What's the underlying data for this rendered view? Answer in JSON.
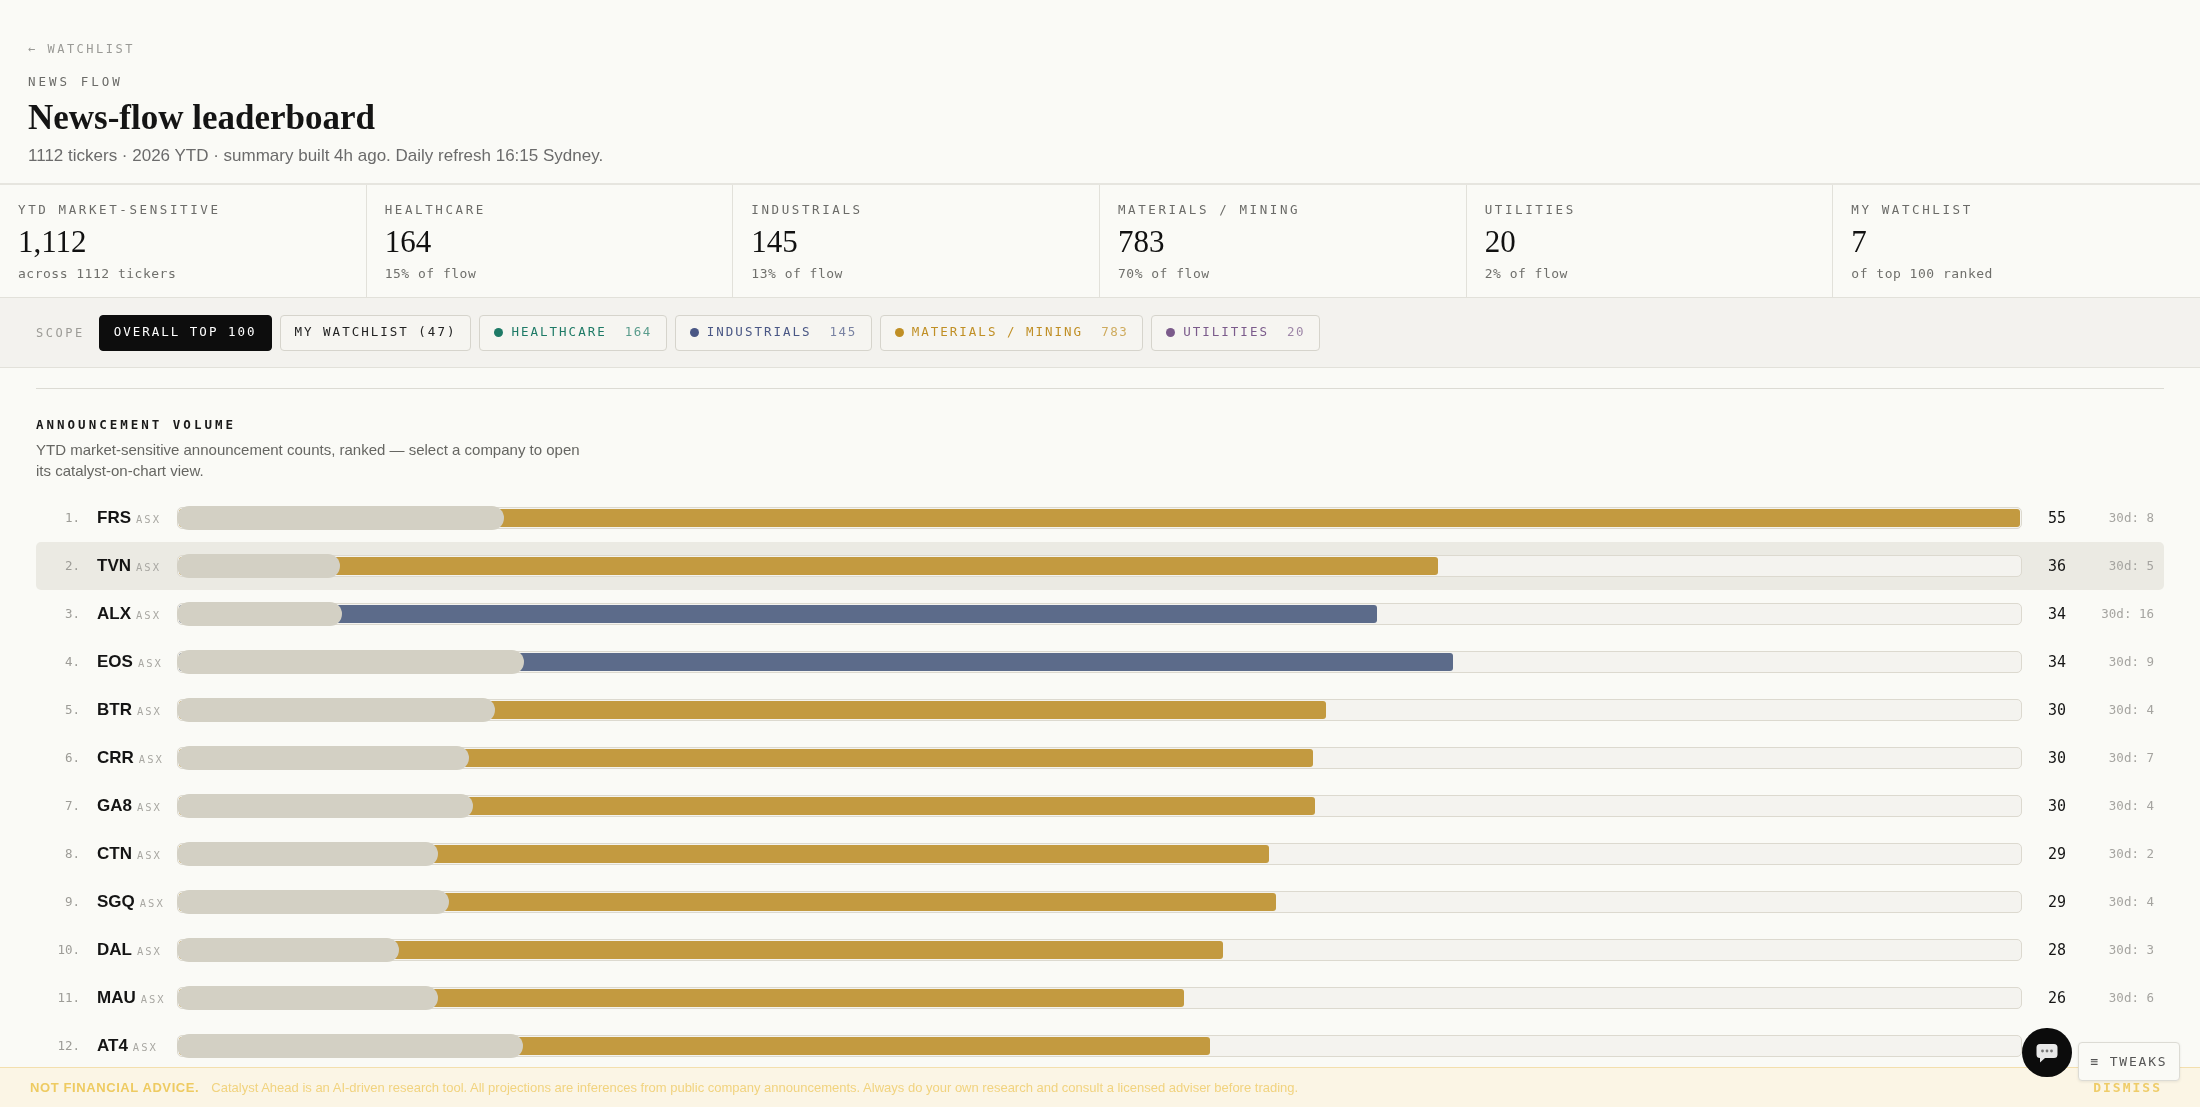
{
  "header": {
    "back_link": "← WATCHLIST",
    "eyebrow": "NEWS FLOW",
    "title": "News-flow leaderboard",
    "subtitle": "1112 tickers · 2026 YTD · summary built 4h ago. Daily refresh 16:15 Sydney."
  },
  "stats": [
    {
      "label": "YTD MARKET-SENSITIVE",
      "value": "1,112",
      "note": "across 1112 tickers"
    },
    {
      "label": "HEALTHCARE",
      "value": "164",
      "note": "15% of flow"
    },
    {
      "label": "INDUSTRIALS",
      "value": "145",
      "note": "13% of flow"
    },
    {
      "label": "MATERIALS / MINING",
      "value": "783",
      "note": "70% of flow"
    },
    {
      "label": "UTILITIES",
      "value": "20",
      "note": "2% of flow"
    },
    {
      "label": "MY WATCHLIST",
      "value": "7",
      "note": "of top 100 ranked"
    }
  ],
  "scope": {
    "label": "SCOPE",
    "chips": [
      {
        "kind": "filter",
        "label": "OVERALL TOP 100",
        "selected": true
      },
      {
        "kind": "filter",
        "label": "MY WATCHLIST (47)",
        "selected": false
      },
      {
        "kind": "sector",
        "label": "HEALTHCARE",
        "count": "164",
        "color": "#1e7a66",
        "selected": false
      },
      {
        "kind": "sector",
        "label": "INDUSTRIALS",
        "count": "145",
        "color": "#4a5785",
        "selected": false
      },
      {
        "kind": "sector",
        "label": "MATERIALS / MINING",
        "count": "783",
        "color": "#c08f25",
        "selected": false
      },
      {
        "kind": "sector",
        "label": "UTILITIES",
        "count": "20",
        "color": "#7b5b8b",
        "selected": false
      }
    ]
  },
  "volume": {
    "title": "ANNOUNCEMENT VOLUME",
    "description": "YTD market-sensitive announcement counts, ranked — select a company to open its catalyst-on-chart view.",
    "rows": [
      {
        "rank": "1.",
        "ticker": "FRS",
        "exchange": "ASX",
        "color": "#c39a40",
        "secondary_bar": {
          "level": 0.177
        },
        "primary_bar": {
          "level": 1.0
        },
        "count": "55",
        "recent": "30d: 8",
        "selected": false
      },
      {
        "rank": "2.",
        "ticker": "TVN",
        "exchange": "ASX",
        "color": "#c39a40",
        "secondary_bar": {
          "level": 0.088
        },
        "primary_bar": {
          "level": 0.684
        },
        "count": "36",
        "recent": "30d: 5",
        "selected": true
      },
      {
        "rank": "3.",
        "ticker": "ALX",
        "exchange": "ASX",
        "color": "#5c6b8a",
        "secondary_bar": {
          "level": 0.089
        },
        "primary_bar": {
          "level": 0.651
        },
        "count": "34",
        "recent": "30d: 16",
        "selected": false
      },
      {
        "rank": "4.",
        "ticker": "EOS",
        "exchange": "ASX",
        "color": "#5c6b8a",
        "secondary_bar": {
          "level": 0.188
        },
        "primary_bar": {
          "level": 0.692
        },
        "count": "34",
        "recent": "30d: 9",
        "selected": false
      },
      {
        "rank": "5.",
        "ticker": "BTR",
        "exchange": "ASX",
        "color": "#c39a40",
        "secondary_bar": {
          "level": 0.172
        },
        "primary_bar": {
          "level": 0.623
        },
        "count": "30",
        "recent": "30d: 4",
        "selected": false
      },
      {
        "rank": "6.",
        "ticker": "CRR",
        "exchange": "ASX",
        "color": "#c39a40",
        "secondary_bar": {
          "level": 0.158
        },
        "primary_bar": {
          "level": 0.616
        },
        "count": "30",
        "recent": "30d: 7",
        "selected": false
      },
      {
        "rank": "7.",
        "ticker": "GA8",
        "exchange": "ASX",
        "color": "#c39a40",
        "secondary_bar": {
          "level": 0.16
        },
        "primary_bar": {
          "level": 0.617
        },
        "count": "30",
        "recent": "30d: 4",
        "selected": false
      },
      {
        "rank": "8.",
        "ticker": "CTN",
        "exchange": "ASX",
        "color": "#c39a40",
        "secondary_bar": {
          "level": 0.141
        },
        "primary_bar": {
          "level": 0.592
        },
        "count": "29",
        "recent": "30d: 2",
        "selected": false
      },
      {
        "rank": "9.",
        "ticker": "SGQ",
        "exchange": "ASX",
        "color": "#c39a40",
        "secondary_bar": {
          "level": 0.147
        },
        "primary_bar": {
          "level": 0.596
        },
        "count": "29",
        "recent": "30d: 4",
        "selected": false
      },
      {
        "rank": "10.",
        "ticker": "DAL",
        "exchange": "ASX",
        "color": "#c39a40",
        "secondary_bar": {
          "level": 0.12
        },
        "primary_bar": {
          "level": 0.567
        },
        "count": "28",
        "recent": "30d: 3",
        "selected": false
      },
      {
        "rank": "11.",
        "ticker": "MAU",
        "exchange": "ASX",
        "color": "#c39a40",
        "secondary_bar": {
          "level": 0.141
        },
        "primary_bar": {
          "level": 0.546
        },
        "count": "26",
        "recent": "30d: 6",
        "selected": false
      },
      {
        "rank": "12.",
        "ticker": "AT4",
        "exchange": "ASX",
        "color": "#c39a40",
        "secondary_bar": {
          "level": 0.187
        },
        "primary_bar": {
          "level": 0.56
        },
        "selected": false
      }
    ]
  },
  "disclaimer": {
    "label": "NOT FINANCIAL ADVICE.",
    "text": "Catalyst Ahead is an AI-driven research tool. All projections are inferences from public company announcements. Always do your own research and consult a licensed adviser before trading.",
    "dismiss": "DISMISS"
  },
  "floating": {
    "tweaks": "≡ TWEAKS"
  }
}
